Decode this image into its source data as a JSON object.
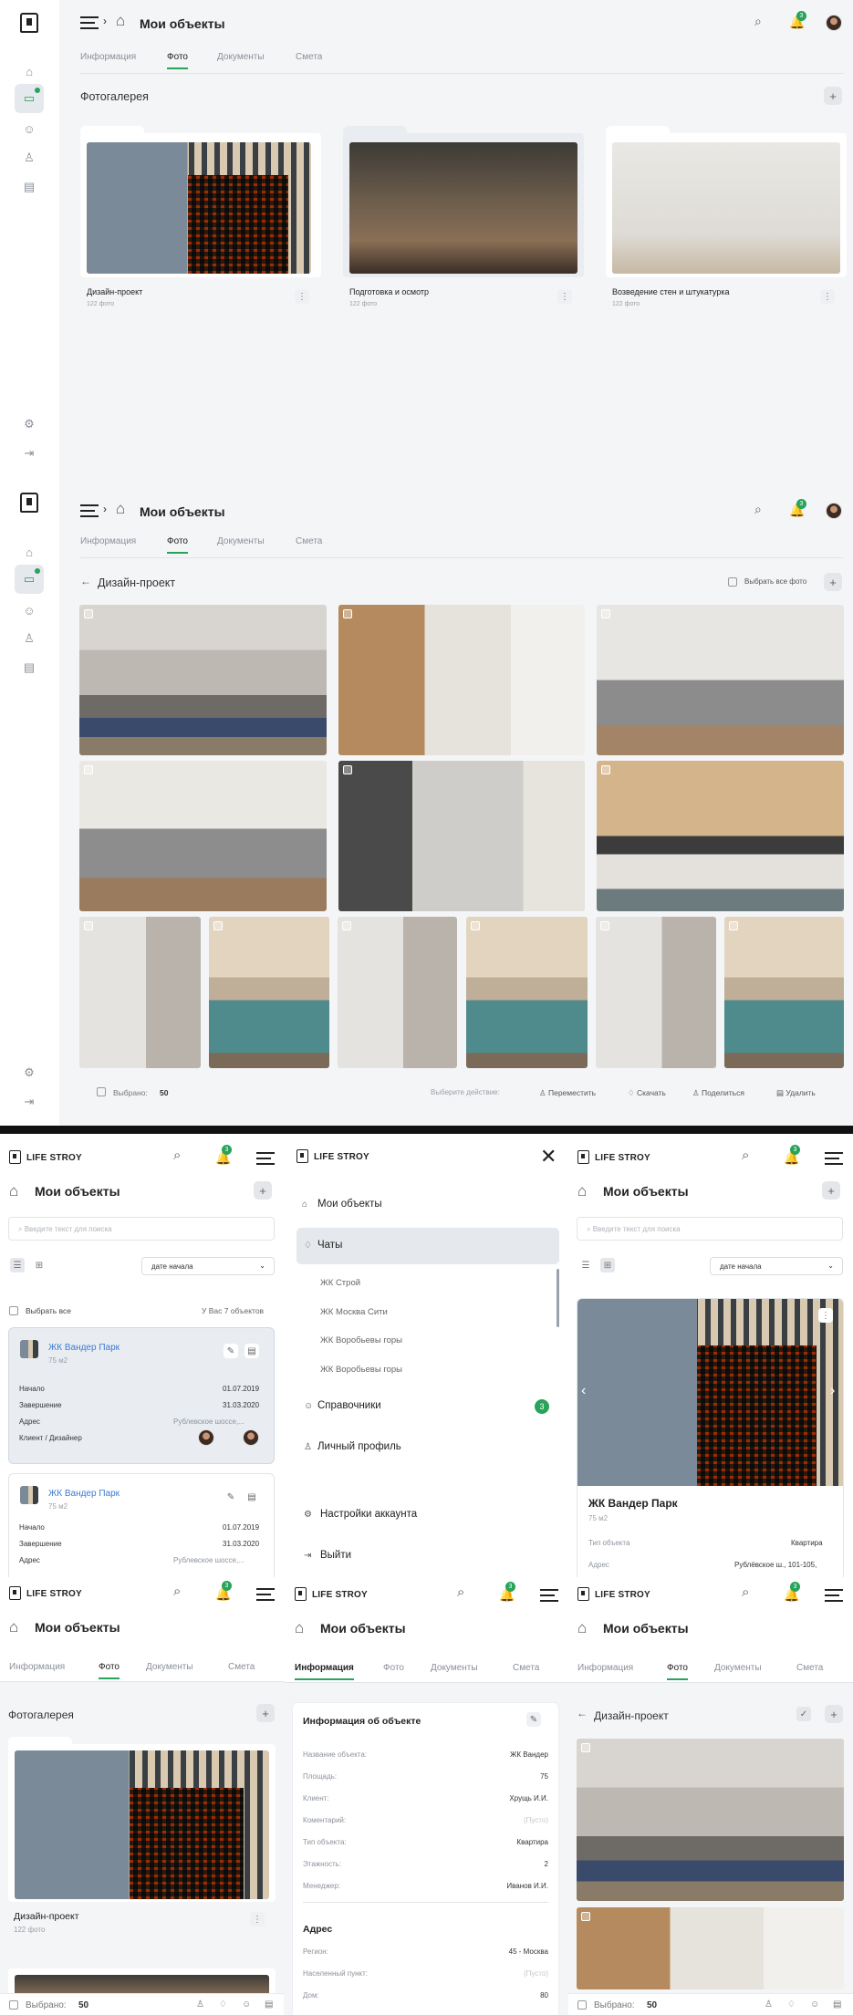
{
  "app": {
    "title": "Мои объекты",
    "brand": "LIFE STROY",
    "notif_count": "3"
  },
  "tabs": [
    "Информация",
    "Фото",
    "Документы",
    "Смета"
  ],
  "gallery": {
    "title": "Фотогалерея",
    "folders": [
      {
        "name": "Дизайн-проект",
        "count": "122 фото"
      },
      {
        "name": "Подготовка и осмотр",
        "count": "122 фото"
      },
      {
        "name": "Возведение стен и штукатурка",
        "count": "122 фото"
      }
    ]
  },
  "folder_view": {
    "title": "Дизайн-проект",
    "select_all": "Выбрать все фото",
    "selected_label": "Выбрано:",
    "selected_count": "50",
    "choose_action": "Выберите действие:",
    "actions": [
      "Переместить",
      "Скачать",
      "Поделиться",
      "Удалить"
    ]
  },
  "mobile_list": {
    "search_placeholder": "Введите текст для поиска",
    "sort": "дате начала",
    "select_all": "Выбрать все",
    "total": "У Вас 7 объектов",
    "objects": [
      {
        "name": "ЖК Вандер Парк",
        "area": "75 м2",
        "start_label": "Начало",
        "start": "01.07.2019",
        "end_label": "Завершение",
        "end": "31.03.2020",
        "address_label": "Адрес",
        "address": "Рублевское шоссе,...",
        "client_label": "Клиент / Дизайнер"
      },
      {
        "name": "ЖК Вандер Парк",
        "area": "75 м2",
        "start_label": "Начало",
        "start": "01.07.2019",
        "end_label": "Завершение",
        "end": "31.03.2020",
        "address_label": "Адрес",
        "address": "Рублевское шоссе,..."
      }
    ]
  },
  "menu": {
    "items": [
      "Мои объекты",
      "Чаты",
      "Справочники",
      "Личный профиль",
      "Настройки аккаунта",
      "Выйти"
    ],
    "chats": [
      "ЖК Строй",
      "ЖК Москва Сити",
      "ЖК Воробьевы горы",
      "ЖК Воробьевы горы"
    ],
    "ref_count": "3"
  },
  "mobile_card": {
    "name": "ЖК Вандер Парк",
    "area": "75 м2",
    "type_label": "Тип объекта",
    "type": "Квартира",
    "address_label": "Адрес",
    "address": "Рублёвское ш., 101-105,"
  },
  "mobile_gallery": {
    "title": "Фотогалерея",
    "folder": "Дизайн-проект",
    "count": "122 фото",
    "selected_label": "Выбрано:",
    "selected_count": "50"
  },
  "info": {
    "title": "Информация об объекте",
    "rows": [
      [
        "Название объекта:",
        "ЖК Вандер"
      ],
      [
        "Площадь:",
        "75"
      ],
      [
        "Клиент:",
        "Хрущь И.И."
      ],
      [
        "Коментарий:",
        "(Пусто)"
      ],
      [
        "Тип объекта:",
        "Квартира"
      ],
      [
        "Этажность:",
        "2"
      ],
      [
        "Менеджер:",
        "Иванов И.И."
      ]
    ],
    "addr_title": "Адрес",
    "addr_rows": [
      [
        "Регион:",
        "45 - Москва"
      ],
      [
        "Населенный пункт:",
        "(Пусто)"
      ],
      [
        "Дом:",
        "80"
      ]
    ]
  },
  "mobile_folder": {
    "title": "Дизайн-проект",
    "selected_label": "Выбрано:",
    "selected_count": "50"
  }
}
